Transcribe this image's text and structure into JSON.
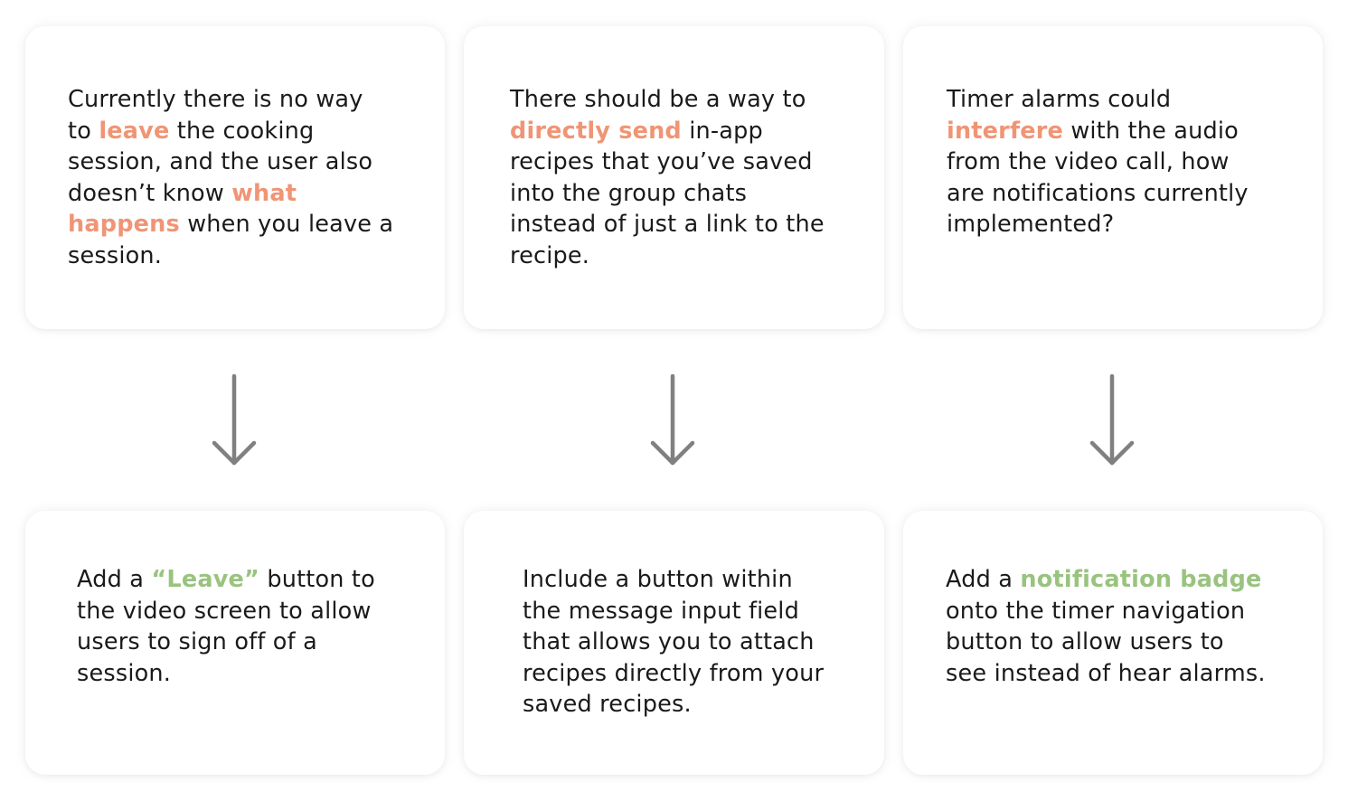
{
  "colors": {
    "issue_highlight": "#ef9575",
    "solution_highlight": "#99c37f",
    "arrow": "#808080",
    "text": "#1a1a1a"
  },
  "flows": [
    {
      "problem": {
        "lines": [
          [
            {
              "t": "Currently there is no way"
            }
          ],
          [
            {
              "t": "to "
            },
            {
              "t": "leave",
              "hl": "issue"
            },
            {
              "t": " the cooking"
            }
          ],
          [
            {
              "t": "session, and the user also"
            }
          ],
          [
            {
              "t": "doesn’t know "
            },
            {
              "t": "what",
              "hl": "issue"
            }
          ],
          [
            {
              "t": "happens",
              "hl": "issue"
            },
            {
              "t": " when you leave a"
            }
          ],
          [
            {
              "t": "session."
            }
          ]
        ]
      },
      "arrow_icon": "down-arrow-icon",
      "solution": {
        "lines": [
          [
            {
              "t": "Add a "
            },
            {
              "t": "“Leave”",
              "hl": "fix"
            },
            {
              "t": " button to"
            }
          ],
          [
            {
              "t": "the video screen to allow"
            }
          ],
          [
            {
              "t": "users to sign off of a"
            }
          ],
          [
            {
              "t": "session."
            }
          ]
        ]
      }
    },
    {
      "problem": {
        "lines": [
          [
            {
              "t": "There should be a way to"
            }
          ],
          [
            {
              "t": "directly send",
              "hl": "issue"
            },
            {
              "t": " in-app"
            }
          ],
          [
            {
              "t": "recipes that you’ve saved"
            }
          ],
          [
            {
              "t": "into the group chats"
            }
          ],
          [
            {
              "t": "instead of just a link to the"
            }
          ],
          [
            {
              "t": "recipe."
            }
          ]
        ]
      },
      "arrow_icon": "down-arrow-icon",
      "solution": {
        "lines": [
          [
            {
              "t": "Include a button within"
            }
          ],
          [
            {
              "t": "the message input field"
            }
          ],
          [
            {
              "t": "that allows you to attach"
            }
          ],
          [
            {
              "t": "recipes directly from your"
            }
          ],
          [
            {
              "t": "saved recipes."
            }
          ]
        ]
      }
    },
    {
      "problem": {
        "lines": [
          [
            {
              "t": "Timer alarms could"
            }
          ],
          [
            {
              "t": "interfere",
              "hl": "issue"
            },
            {
              "t": " with the audio"
            }
          ],
          [
            {
              "t": "from the video call, how"
            }
          ],
          [
            {
              "t": "are notifications currently"
            }
          ],
          [
            {
              "t": "implemented?"
            }
          ]
        ]
      },
      "arrow_icon": "down-arrow-icon",
      "solution": {
        "lines": [
          [
            {
              "t": "Add a "
            },
            {
              "t": "notification badge",
              "hl": "fix"
            }
          ],
          [
            {
              "t": "onto the timer navigation"
            }
          ],
          [
            {
              "t": "button to allow users to"
            }
          ],
          [
            {
              "t": "see instead of hear alarms."
            }
          ]
        ]
      }
    }
  ]
}
